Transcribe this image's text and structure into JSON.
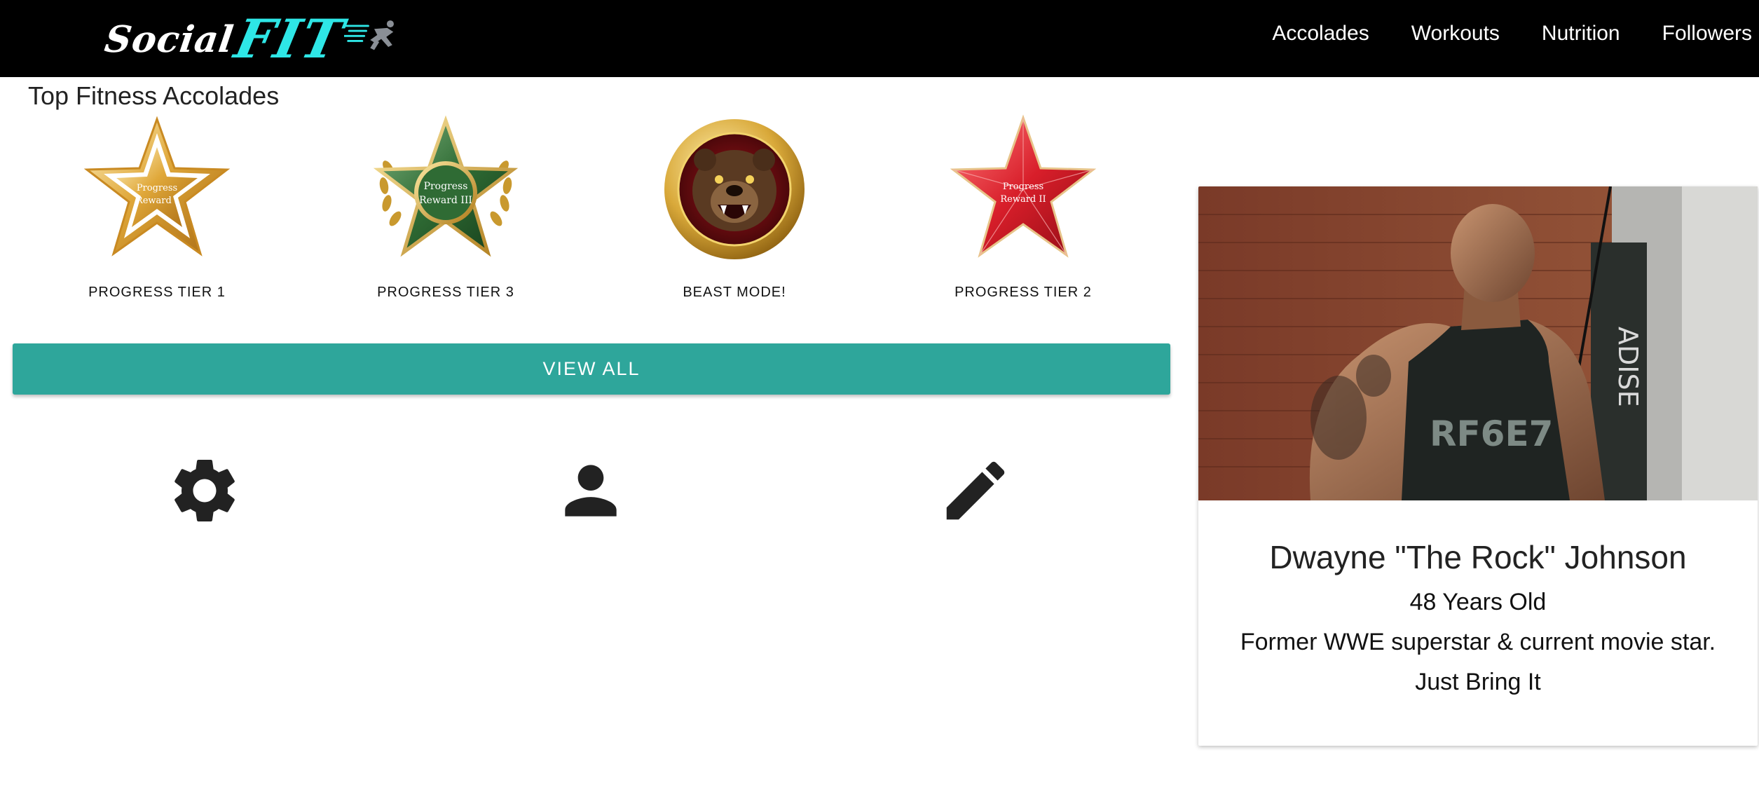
{
  "app": {
    "logo_text_1": "Social",
    "logo_text_2": "FIT",
    "accent_color": "#2ea69b",
    "logo_color": "#2ee6e6"
  },
  "nav": {
    "items": [
      {
        "label": "Accolades"
      },
      {
        "label": "Workouts"
      },
      {
        "label": "Nutrition"
      },
      {
        "label": "Followers"
      }
    ]
  },
  "accolades": {
    "title": "Top Fitness Accolades",
    "badges": [
      {
        "label": "PROGRESS TIER 1",
        "icon": "gold-star-badge-icon",
        "inscription": [
          "Progress",
          "Reward I"
        ]
      },
      {
        "label": "PROGRESS TIER 3",
        "icon": "green-star-laurel-badge-icon",
        "inscription": [
          "Progress",
          "Reward III"
        ]
      },
      {
        "label": "BEAST MODE!",
        "icon": "bear-medallion-badge-icon",
        "inscription": []
      },
      {
        "label": "PROGRESS TIER 2",
        "icon": "red-star-badge-icon",
        "inscription": [
          "Progress",
          "Reward II"
        ]
      }
    ],
    "view_all_label": "VIEW ALL"
  },
  "actions": [
    {
      "icon": "gear-icon"
    },
    {
      "icon": "person-icon"
    },
    {
      "icon": "pencil-icon"
    }
  ],
  "profile": {
    "name": "Dwayne \"The Rock\" Johnson",
    "age": "48 Years Old",
    "bio": "Former WWE superstar & current movie star.",
    "motto": "Just Bring It"
  }
}
